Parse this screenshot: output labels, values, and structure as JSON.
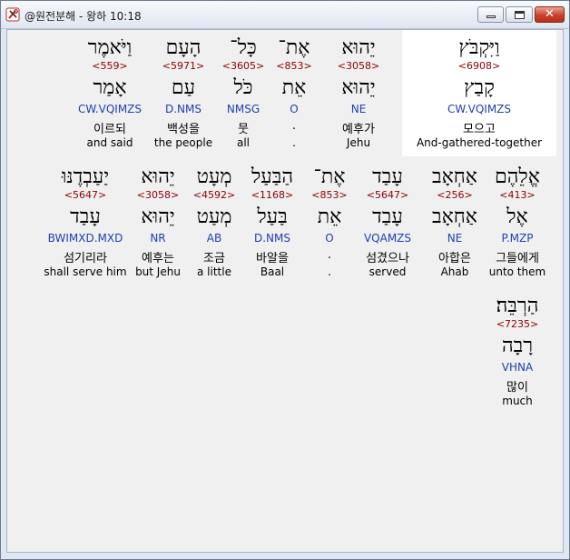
{
  "window": {
    "title": "@원전분해 - 왕하 10:18"
  },
  "rows": [
    [
      {
        "heb": "וַיִּקְבֹּץ",
        "num": "<6908>",
        "lex": "קָבַץ",
        "parse": "CW.VQIMZS",
        "kor": "모으고",
        "eng": "And-gathered-together",
        "selected": true
      },
      {
        "heb": "יֵהוּא",
        "num": "<3058>",
        "lex": "יֵהוּא",
        "parse": "NE",
        "kor": "예후가",
        "eng": "Jehu"
      },
      {
        "heb": "אֶת־",
        "num": "<853>",
        "lex": "אֵת",
        "parse": "O",
        "kor": ".",
        "eng": "."
      },
      {
        "heb": "כָּל־",
        "num": "<3605>",
        "lex": "כֹּל",
        "parse": "NMSG",
        "kor": "뭇",
        "eng": "all"
      },
      {
        "heb": "הָעָם",
        "num": "<5971>",
        "lex": "עַם",
        "parse": "D.NMS",
        "kor": "백성을",
        "eng": "the people"
      },
      {
        "heb": "וַיֹּאמֶר",
        "num": "<559>",
        "lex": "אָמַר",
        "parse": "CW.VQIMZS",
        "kor": "이르되",
        "eng": "and said"
      }
    ],
    [
      {
        "heb": "אֱלֵהֶם",
        "num": "<413>",
        "lex": "אֶל",
        "parse": "P.MZP",
        "kor": "그들에게",
        "eng": "unto them"
      },
      {
        "heb": "אַחְאָב",
        "num": "<256>",
        "lex": "אַחְאָב",
        "parse": "NE",
        "kor": "아합은",
        "eng": "Ahab"
      },
      {
        "heb": "עָבַד",
        "num": "<5647>",
        "lex": "עָבַד",
        "parse": "VQAMZS",
        "kor": "섬겼으나",
        "eng": "served"
      },
      {
        "heb": "אֶת־",
        "num": "<853>",
        "lex": "אֵת",
        "parse": "O",
        "kor": ".",
        "eng": "."
      },
      {
        "heb": "הַבַּעַל",
        "num": "<1168>",
        "lex": "בַּעַל",
        "parse": "D.NMS",
        "kor": "바알을",
        "eng": "Baal"
      },
      {
        "heb": "מְעָט",
        "num": "<4592>",
        "lex": "מְעַט",
        "parse": "AB",
        "kor": "조금",
        "eng": "a little"
      },
      {
        "heb": "יֵהוּא",
        "num": "<3058>",
        "lex": "יֵהוּא",
        "parse": "NR",
        "kor": "예후는",
        "eng": "but Jehu"
      },
      {
        "heb": "יַעַבְדֶנּוּ",
        "num": "<5647>",
        "lex": "עָבַד",
        "parse": "BWIMXD.MXD",
        "kor": "섬기리라",
        "eng": "shall serve him"
      }
    ],
    [
      {
        "heb": "הַרְבֵּה׃",
        "num": "<7235>",
        "lex": "רָבָה",
        "parse": "VHNA",
        "kor": "많이",
        "eng": "much"
      }
    ]
  ],
  "colors": {
    "number": "#8b0000",
    "parse": "#1f3fb0",
    "selected_bg": "#ffffff"
  },
  "icons": {
    "app": "tools-icon",
    "minimize": "minimize-icon",
    "maximize": "maximize-icon",
    "close": "close-icon"
  }
}
